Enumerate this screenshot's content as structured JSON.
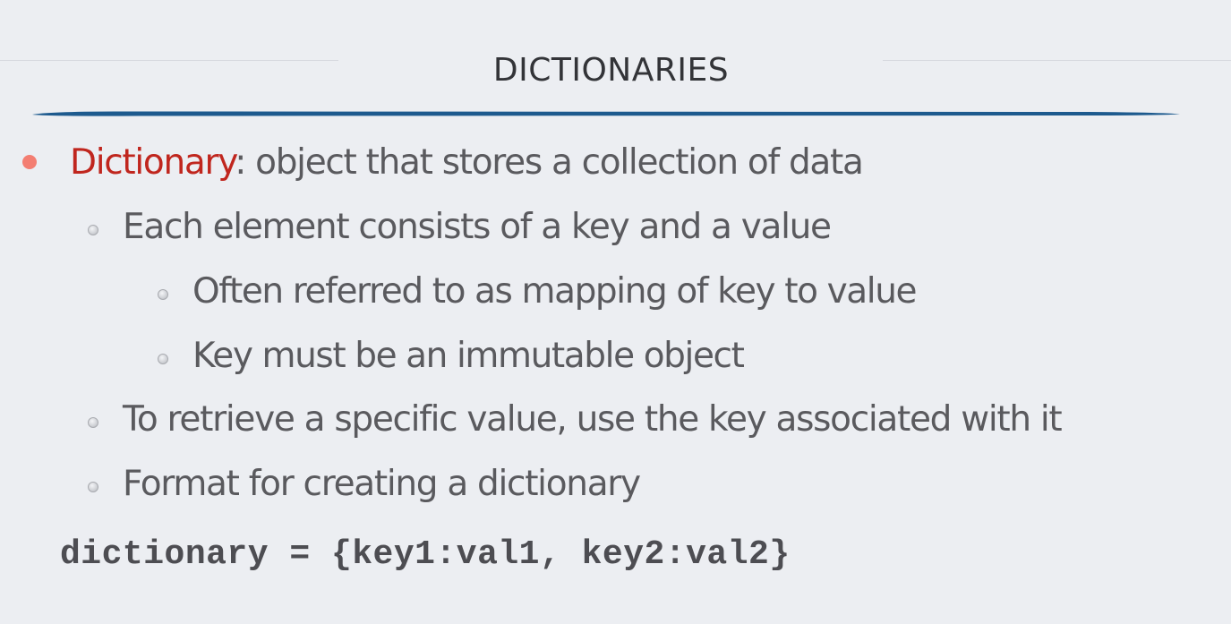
{
  "slide": {
    "title": "DICTIONARIES",
    "bullets": [
      {
        "term": "Dictionary",
        "text": ": object that stores a collection of data"
      },
      {
        "text": "Each element consists of a key and a value"
      },
      {
        "text": "Often referred to as mapping of key to value"
      },
      {
        "text": "Key must be an immutable object"
      },
      {
        "text": "To retrieve a specific value, use the key associated with it"
      },
      {
        "text": "Format for creating a dictionary"
      }
    ],
    "code": "dictionary = {key1:val1, key2:val2}"
  },
  "colors": {
    "background": "#eceef2",
    "title_underline": "#1d5a8e",
    "term_accent": "#c0261e",
    "main_bullet": "#f37e72",
    "body_text": "#5a5a5e"
  }
}
